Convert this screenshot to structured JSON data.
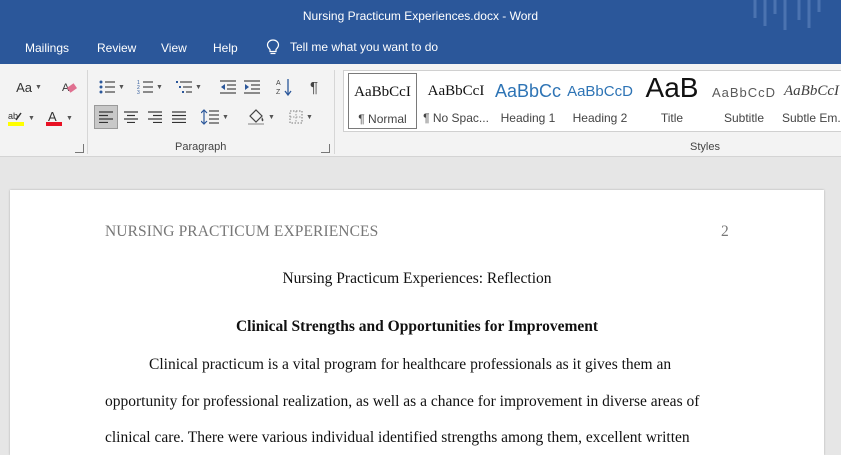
{
  "window": {
    "title": "Nursing Practicum Experiences.docx  -  Word"
  },
  "menu": {
    "items": [
      "Mailings",
      "Review",
      "View",
      "Help"
    ],
    "tell_me": "Tell me what you want to do"
  },
  "ribbon": {
    "font_group": {
      "change_case": "Aa"
    },
    "paragraph_label": "Paragraph",
    "styles_label": "Styles",
    "styles": [
      {
        "preview": "AaBbCcI",
        "name": "¶ Normal"
      },
      {
        "preview": "AaBbCcI",
        "name": "¶ No Spac..."
      },
      {
        "preview": "AaBbCc",
        "name": "Heading 1"
      },
      {
        "preview": "AaBbCcD",
        "name": "Heading 2"
      },
      {
        "preview": "AaB",
        "name": "Title"
      },
      {
        "preview": "AaBbCcD",
        "name": "Subtitle"
      },
      {
        "preview": "AaBbCcI",
        "name": "Subtle Em..."
      }
    ]
  },
  "colors": {
    "accent": "#2b579a",
    "highlight": "#ffff00",
    "font_color": "#e81123"
  },
  "document": {
    "running_head": "NURSING PRACTICUM EXPERIENCES",
    "page_number": "2",
    "title": "Nursing Practicum Experiences: Reflection",
    "heading": "Clinical Strengths and Opportunities for Improvement",
    "lines": [
      "Clinical practicum is a vital program for healthcare professionals as it gives them an",
      "opportunity for professional realization, as well as a chance for improvement in diverse areas of",
      "clinical care. There were various individual identified strengths among them, excellent written"
    ]
  }
}
